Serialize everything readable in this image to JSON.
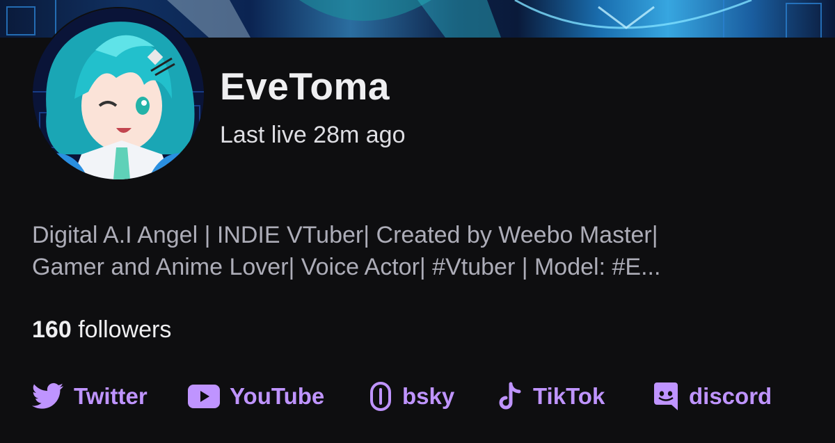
{
  "profile": {
    "name": "EveToma",
    "last_live": "Last live 28m ago",
    "bio_line1": "Digital A.I Angel | INDIE VTuber| Created by Weebo Master|",
    "bio_line2": "Gamer and Anime Lover| Voice Actor| #Vtuber | Model: #E...",
    "followers_count": "160",
    "followers_label": "followers"
  },
  "links": [
    {
      "label": "Twitter",
      "icon": "twitter-bird-icon"
    },
    {
      "label": "YouTube",
      "icon": "youtube-play-icon"
    },
    {
      "label": "bsky",
      "icon": "chain-link-icon"
    },
    {
      "label": "TikTok",
      "icon": "tiktok-note-icon"
    },
    {
      "label": "discord",
      "icon": "discord-chat-icon"
    }
  ],
  "colors": {
    "background": "#0e0e10",
    "link_accent": "#bf94ff",
    "primary_text": "#efeff1",
    "muted_text": "#adadb8"
  }
}
